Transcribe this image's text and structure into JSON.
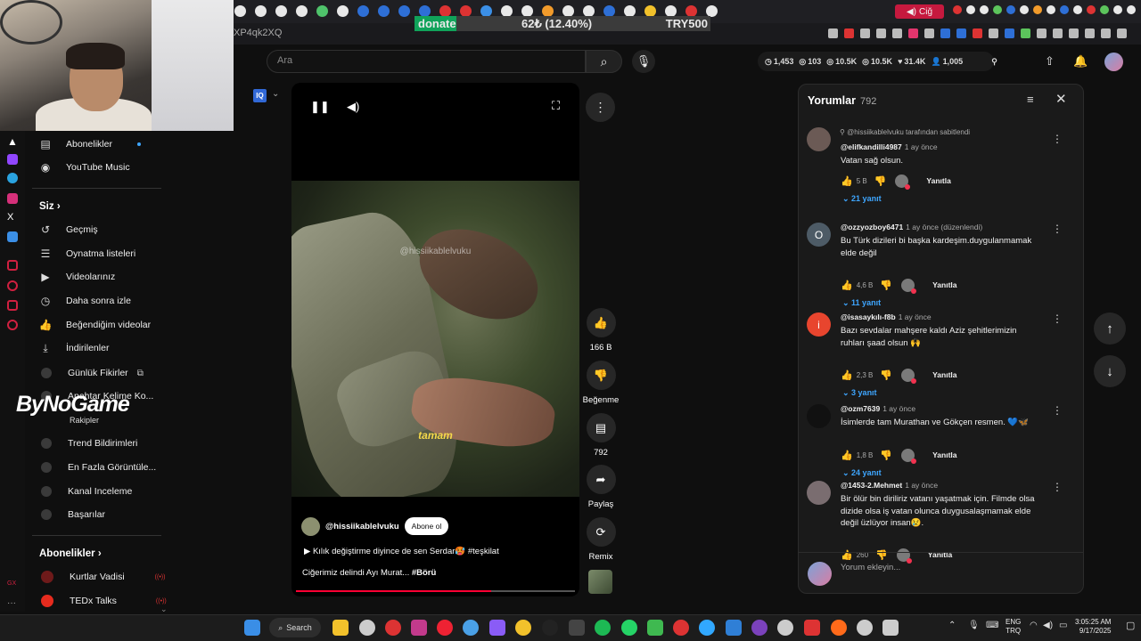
{
  "browser": {
    "url_fragment": "XP4qk2XQ",
    "donate": {
      "label": "donate",
      "amount": "62₺ (12.40%)",
      "goal": "TRY500",
      "progress_fraction": 0.124
    },
    "cig_label": "Ciğ"
  },
  "search": {
    "placeholder": "Ara"
  },
  "stats": [
    {
      "icon": "clock-icon",
      "value": "1,453"
    },
    {
      "icon": "eye-icon",
      "value": "103"
    },
    {
      "icon": "eye-icon",
      "value": "10.5K"
    },
    {
      "icon": "eye-icon",
      "value": "10.5K"
    },
    {
      "icon": "like-icon",
      "value": "31.4K"
    },
    {
      "icon": "user-icon",
      "value": "1,005"
    }
  ],
  "sidebar": {
    "top_items": [
      {
        "label": "Abonelikler",
        "icon": "subscriptions-icon"
      },
      {
        "label": "YouTube Music",
        "icon": "music-icon"
      }
    ],
    "you_header": "Siz",
    "you_items": [
      {
        "label": "Geçmiş",
        "icon": "history-icon"
      },
      {
        "label": "Oynatma listeleri",
        "icon": "playlist-icon"
      },
      {
        "label": "Videolarınız",
        "icon": "video-icon"
      },
      {
        "label": "Daha sonra izle",
        "icon": "clock-icon"
      },
      {
        "label": "Beğendiğim videolar",
        "icon": "like-icon"
      },
      {
        "label": "İndirilenler",
        "icon": "download-icon"
      }
    ],
    "tools": [
      {
        "label": "Günlük Fikirler"
      },
      {
        "label": "Anahtar Kelime Ko..."
      },
      {
        "label": "Trend Bildirimleri"
      },
      {
        "label": "En Fazla Görüntüle..."
      },
      {
        "label": "Kanal Inceleme"
      },
      {
        "label": "Başarılar"
      }
    ],
    "rakipler": "Rakipler",
    "subs_header": "Abonelikler",
    "subs": [
      {
        "label": "Kurtlar Vadisi"
      },
      {
        "label": "TEDx Talks"
      }
    ]
  },
  "overlay_logo": "ByNoGame",
  "video": {
    "watermark": "@hissiikablelvuku",
    "subtitle": "tamam",
    "channel": "@hissiikablelvuku",
    "subscribe_label": "Abone ol",
    "caption_line1": "Kılık değiştirme diyince de sen Serdar🥵 #teşkilat",
    "caption_line2_prefix": "Ciğerimiz delindi Ayı Murat... ",
    "caption_line2_tag": "#Börü",
    "progress_fraction": 0.7
  },
  "actions": {
    "like_count": "166 B",
    "dislike_label": "Beğenme",
    "comments_count": "792",
    "share_label": "Paylaş",
    "remix_label": "Remix"
  },
  "comments": {
    "title": "Yorumlar",
    "count": "792",
    "pinned_note": "@hissiikablelvuku tarafından sabitlendi",
    "reply_label": "Yanıtla",
    "input_placeholder": "Yorum ekleyin...",
    "items": [
      {
        "user": "@elifkandilli4987",
        "time": "1 ay önce",
        "text": "Vatan sağ olsun.",
        "likes": "5 B",
        "replies": "21 yanıt",
        "avatar_color": "#6b5a55"
      },
      {
        "user": "@ozzyozboy6471",
        "time": "1 ay önce (düzenlendi)",
        "text": "Bu Türk dizileri bi başka kardeşim.duygulanmamak elde değil",
        "likes": "4,6 B",
        "replies": "11 yanıt",
        "avatar_letter": "O",
        "avatar_color": "#4d5b66"
      },
      {
        "user": "@isasaykılı-f8b",
        "time": "1 ay önce",
        "text": "Bazı sevdalar mahşere kaldı Aziz şehitlerimizin ruhları şaad olsun 🙌",
        "likes": "2,3 B",
        "replies": "3 yanıt",
        "avatar_letter": "i",
        "avatar_color": "#e8452e"
      },
      {
        "user": "@ozm7639",
        "time": "1 ay önce",
        "text": "İsimlerde tam Murathan ve Gökçen resmen. 💙🦋",
        "likes": "1,8 B",
        "replies": "24 yanıt",
        "avatar_color": "#111111"
      },
      {
        "user": "@1453-2.Mehmet",
        "time": "1 ay önce",
        "text": "Bir ölür bin diriliriz vatanı yaşatmak için. Filmde olsa dizide olsa iş vatan olunca duygusalaşmamak elde değil üzlüyor insan😢.",
        "likes": "260",
        "avatar_color": "#7a6d70"
      }
    ]
  },
  "taskbar": {
    "search_label": "Search",
    "lang_top": "ENG",
    "lang_bottom": "TRQ",
    "time": "3:05:25 AM",
    "date": "9/17/2025"
  }
}
